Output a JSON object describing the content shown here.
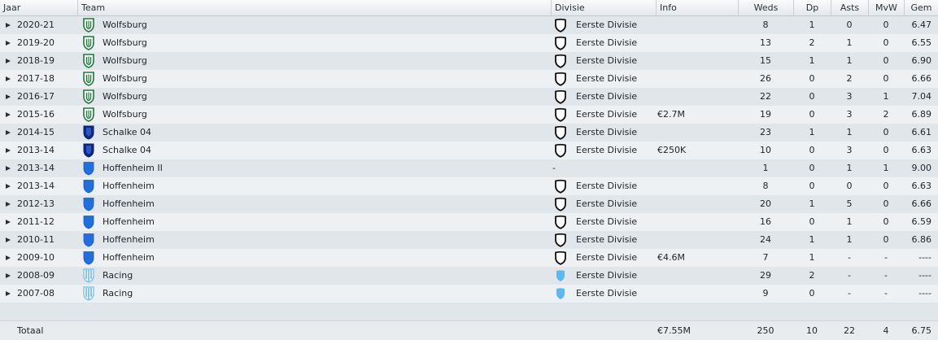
{
  "headers": {
    "jaar": "Jaar",
    "team": "Team",
    "divisie": "Divisie",
    "info": "Info",
    "weds": "Weds",
    "dp": "Dp",
    "asts": "Asts",
    "mvw": "MvW",
    "gem": "Gem"
  },
  "rows": [
    {
      "year": "2020-21",
      "team": "Wolfsburg",
      "badge": "wolfsburg-crest-icon",
      "division": "Eerste Divisie",
      "div_icon": "shield-black-icon",
      "info": "",
      "weds": "8",
      "dp": "1",
      "asts": "0",
      "mvw": "0",
      "gem": "6.47"
    },
    {
      "year": "2019-20",
      "team": "Wolfsburg",
      "badge": "wolfsburg-crest-icon",
      "division": "Eerste Divisie",
      "div_icon": "shield-black-icon",
      "info": "",
      "weds": "13",
      "dp": "2",
      "asts": "1",
      "mvw": "0",
      "gem": "6.55"
    },
    {
      "year": "2018-19",
      "team": "Wolfsburg",
      "badge": "wolfsburg-crest-icon",
      "division": "Eerste Divisie",
      "div_icon": "shield-black-icon",
      "info": "",
      "weds": "15",
      "dp": "1",
      "asts": "1",
      "mvw": "0",
      "gem": "6.90"
    },
    {
      "year": "2017-18",
      "team": "Wolfsburg",
      "badge": "wolfsburg-crest-icon",
      "division": "Eerste Divisie",
      "div_icon": "shield-black-icon",
      "info": "",
      "weds": "26",
      "dp": "0",
      "asts": "2",
      "mvw": "0",
      "gem": "6.66"
    },
    {
      "year": "2016-17",
      "team": "Wolfsburg",
      "badge": "wolfsburg-crest-icon",
      "division": "Eerste Divisie",
      "div_icon": "shield-black-icon",
      "info": "",
      "weds": "22",
      "dp": "0",
      "asts": "3",
      "mvw": "1",
      "gem": "7.04"
    },
    {
      "year": "2015-16",
      "team": "Wolfsburg",
      "badge": "wolfsburg-crest-icon",
      "division": "Eerste Divisie",
      "div_icon": "shield-black-icon",
      "info": "€2.7M",
      "weds": "19",
      "dp": "0",
      "asts": "3",
      "mvw": "2",
      "gem": "6.89"
    },
    {
      "year": "2014-15",
      "team": "Schalke 04",
      "badge": "schalke-crest-icon",
      "division": "Eerste Divisie",
      "div_icon": "shield-black-icon",
      "info": "",
      "weds": "23",
      "dp": "1",
      "asts": "1",
      "mvw": "0",
      "gem": "6.61"
    },
    {
      "year": "2013-14",
      "team": "Schalke 04",
      "badge": "schalke-crest-icon",
      "division": "Eerste Divisie",
      "div_icon": "shield-black-icon",
      "info": "€250K",
      "weds": "10",
      "dp": "0",
      "asts": "3",
      "mvw": "0",
      "gem": "6.63"
    },
    {
      "year": "2013-14",
      "team": "Hoffenheim II",
      "badge": "hoffenheim-crest-icon",
      "division": "-",
      "div_icon": "",
      "info": "",
      "weds": "1",
      "dp": "0",
      "asts": "1",
      "mvw": "1",
      "gem": "9.00"
    },
    {
      "year": "2013-14",
      "team": "Hoffenheim",
      "badge": "hoffenheim-crest-icon",
      "division": "Eerste Divisie",
      "div_icon": "shield-black-icon",
      "info": "",
      "weds": "8",
      "dp": "0",
      "asts": "0",
      "mvw": "0",
      "gem": "6.63"
    },
    {
      "year": "2012-13",
      "team": "Hoffenheim",
      "badge": "hoffenheim-crest-icon",
      "division": "Eerste Divisie",
      "div_icon": "shield-black-icon",
      "info": "",
      "weds": "20",
      "dp": "1",
      "asts": "5",
      "mvw": "0",
      "gem": "6.66"
    },
    {
      "year": "2011-12",
      "team": "Hoffenheim",
      "badge": "hoffenheim-crest-icon",
      "division": "Eerste Divisie",
      "div_icon": "shield-black-icon",
      "info": "",
      "weds": "16",
      "dp": "0",
      "asts": "1",
      "mvw": "0",
      "gem": "6.59"
    },
    {
      "year": "2010-11",
      "team": "Hoffenheim",
      "badge": "hoffenheim-crest-icon",
      "division": "Eerste Divisie",
      "div_icon": "shield-black-icon",
      "info": "",
      "weds": "24",
      "dp": "1",
      "asts": "1",
      "mvw": "0",
      "gem": "6.86"
    },
    {
      "year": "2009-10",
      "team": "Hoffenheim",
      "badge": "hoffenheim-crest-icon",
      "division": "Eerste Divisie",
      "div_icon": "shield-black-icon",
      "info": "€4.6M",
      "weds": "7",
      "dp": "1",
      "asts": "-",
      "mvw": "-",
      "gem": "----"
    },
    {
      "year": "2008-09",
      "team": "Racing",
      "badge": "racing-crest-icon",
      "division": "Eerste Divisie",
      "div_icon": "shield-lightblue-icon",
      "info": "",
      "weds": "29",
      "dp": "2",
      "asts": "-",
      "mvw": "-",
      "gem": "----"
    },
    {
      "year": "2007-08",
      "team": "Racing",
      "badge": "racing-crest-icon",
      "division": "Eerste Divisie",
      "div_icon": "shield-lightblue-icon",
      "info": "",
      "weds": "9",
      "dp": "0",
      "asts": "-",
      "mvw": "-",
      "gem": "----"
    }
  ],
  "total": {
    "label": "Totaal",
    "info": "€7.55M",
    "weds": "250",
    "dp": "10",
    "asts": "22",
    "mvw": "4",
    "gem": "6.75"
  },
  "colors": {
    "wolfsburg": "#1e7a3a",
    "schalke": "#0b2a8a",
    "hoffenheim": "#1f6fe0",
    "racing": "#7cc3ef"
  }
}
